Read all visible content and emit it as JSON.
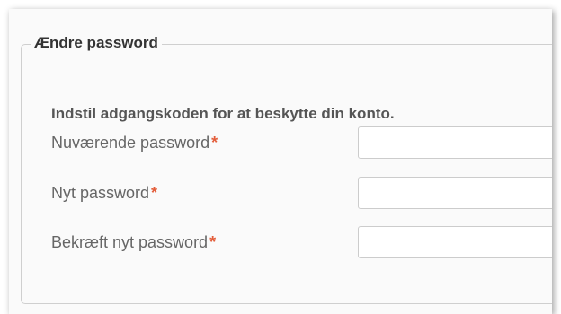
{
  "form": {
    "legend": "Ændre password",
    "description": "Indstil adgangskoden for at beskytte din konto.",
    "required_marker": "*",
    "fields": [
      {
        "label": "Nuværende password",
        "value": ""
      },
      {
        "label": "Nyt password",
        "value": ""
      },
      {
        "label": "Bekræft nyt password",
        "value": ""
      }
    ]
  },
  "colors": {
    "required": "#e35d3a",
    "label": "#666666",
    "heading": "#333333"
  }
}
